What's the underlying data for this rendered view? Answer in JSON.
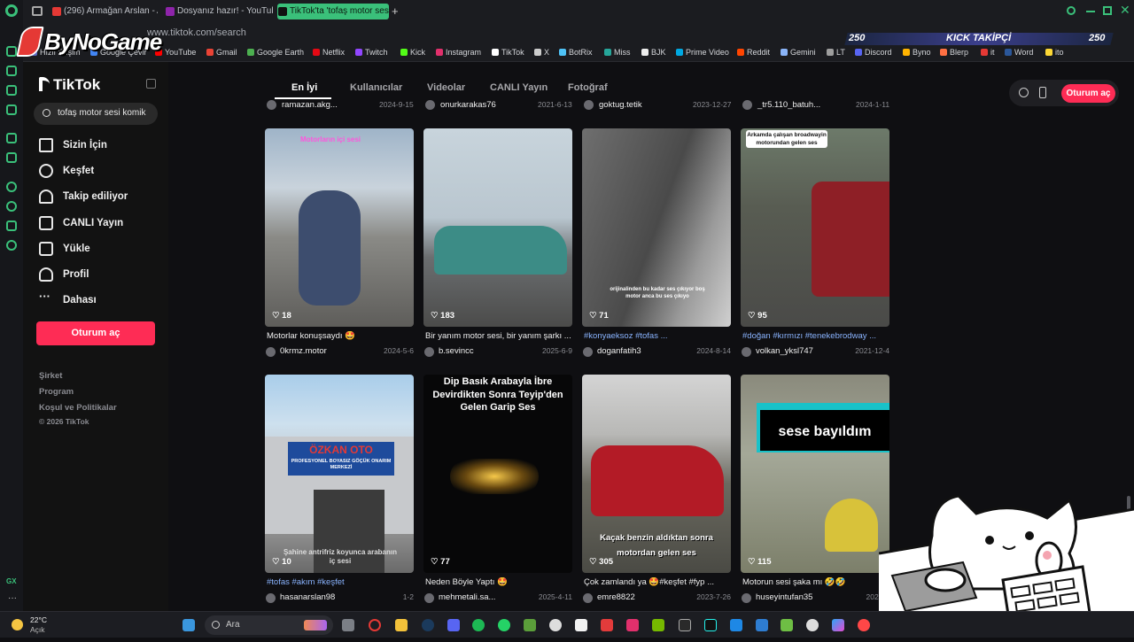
{
  "browser": {
    "tabs": [
      {
        "label": "(296) Armağan Arslan - Ata",
        "color": "#e53935"
      },
      {
        "label": "Dosyanız hazır! - YouTube",
        "color": "#8e24aa"
      },
      {
        "label": "TikTok'ta 'tofaş motor sesi",
        "color": "#111111"
      }
    ],
    "new_tab": "+",
    "url": "www.tiktok.com/search",
    "bookmarks": [
      {
        "label": "Hızlı Erişim",
        "color": "#5c6bc0"
      },
      {
        "label": "Google Çevir",
        "color": "#4285f4"
      },
      {
        "label": "YouTube",
        "color": "#ff0000"
      },
      {
        "label": "Gmail",
        "color": "#ea4335"
      },
      {
        "label": "Google Earth",
        "color": "#4caf50"
      },
      {
        "label": "Netflix",
        "color": "#e50914"
      },
      {
        "label": "Twitch",
        "color": "#9146ff"
      },
      {
        "label": "Kick",
        "color": "#53fc18"
      },
      {
        "label": "Instagram",
        "color": "#e1306c"
      },
      {
        "label": "TikTok",
        "color": "#ffffff"
      },
      {
        "label": "X",
        "color": "#cccccc"
      },
      {
        "label": "BotRix",
        "color": "#4fc3f7"
      },
      {
        "label": "Miss",
        "color": "#26a69a"
      },
      {
        "label": "BJK",
        "color": "#eeeeee"
      },
      {
        "label": "Prime Video",
        "color": "#00a8e1"
      },
      {
        "label": "Reddit",
        "color": "#ff4500"
      },
      {
        "label": "Gemini",
        "color": "#8ab4f8"
      },
      {
        "label": "LT",
        "color": "#9e9e9e"
      },
      {
        "label": "Discord",
        "color": "#5865f2"
      },
      {
        "label": "Byno",
        "color": "#ffb300"
      },
      {
        "label": "Blerp",
        "color": "#ff7043"
      },
      {
        "label": "it",
        "color": "#e53935"
      },
      {
        "label": "Word",
        "color": "#2b579a"
      },
      {
        "label": "ito",
        "color": "#fdd835"
      }
    ]
  },
  "overlay": {
    "logo": "ByNoGame",
    "kick_label": "KICK TAKİPÇİ",
    "kick_left": "250",
    "kick_right": "250"
  },
  "tiktok": {
    "logo": "TikTok",
    "search_value": "tofaş motor sesi komik",
    "nav": [
      "Sizin İçin",
      "Keşfet",
      "Takip ediliyor",
      "CANLI Yayın",
      "Yükle",
      "Profil",
      "Dahası"
    ],
    "login": "Oturum aç",
    "footer": [
      "Şirket",
      "Program",
      "Koşul ve Politikalar",
      "© 2026 TikTok"
    ],
    "tabs": [
      "En İyi",
      "Kullanıcılar",
      "Videolar",
      "CANLI Yayın",
      "Fotoğraf"
    ],
    "top_row": [
      {
        "user": "ramazan.akg...",
        "date": "2024-9-15"
      },
      {
        "user": "onurkarakas76",
        "date": "2021-6-13"
      },
      {
        "user": "goktug.tetik",
        "date": "2023-12-27"
      },
      {
        "user": "_tr5.110_batuh...",
        "date": "2024-1-11"
      }
    ],
    "videos": [
      {
        "likes": "18",
        "desc": "Motorlar konuşsaydı 🤩",
        "user": "0krmz.motor",
        "date": "2024-5-6",
        "overlay": "Motorların içi sesi"
      },
      {
        "likes": "183",
        "desc": "Bir yanım motor sesi, bir yanım şarkı ...",
        "user": "b.sevincc",
        "date": "2025-6-9",
        "overlay": ""
      },
      {
        "likes": "71",
        "desc": "#konyaeksoz #tofas ...",
        "user": "doganfatih3",
        "date": "2024-8-14",
        "overlay": "orijinalinden bu kadar ses çıkıyor boş motor anca bu ses çıkıyo"
      },
      {
        "likes": "95",
        "desc": "#doğan #kırmızı #tenekebrodway ...",
        "user": "volkan_yksl747",
        "date": "2021-12-4",
        "overlay": "Arkamda çalışan broadwayin motorundan gelen ses"
      },
      {
        "likes": "10",
        "desc": "#tofas #akım #keşfet",
        "user": "hasanarslan98",
        "date": "1-2",
        "overlay": "Şahine antrifriz koyunca arabanın iç sesi",
        "sign": "ÖZKAN OTO",
        "sign2": "PROFESYONEL BOYASIZ GÖÇÜK ONARIM MERKEZİ"
      },
      {
        "likes": "77",
        "desc": "Neden Böyle Yaptı 🤩",
        "user": "mehmetali.sa...",
        "date": "2025-4-11",
        "overlay": "Dip Basık Arabayla İbre Devirdikten Sonra Teyip'den Gelen Garip Ses"
      },
      {
        "likes": "305",
        "desc": "Çok zamlandı ya 🤩#keşfet #fyp ...",
        "user": "emre8822",
        "date": "2023-7-26",
        "overlay": "Kaçak benzin aldıktan sonra motordan gelen ses"
      },
      {
        "likes": "115",
        "desc": "Motorun sesi şaka mı 🤣🤣",
        "user": "huseyintufan35",
        "date": "2024-1",
        "overlay": "sese bayıldım"
      }
    ]
  },
  "taskbar": {
    "weather_temp": "22°C",
    "weather_state": "Açık",
    "search_placeholder": "Ara"
  }
}
